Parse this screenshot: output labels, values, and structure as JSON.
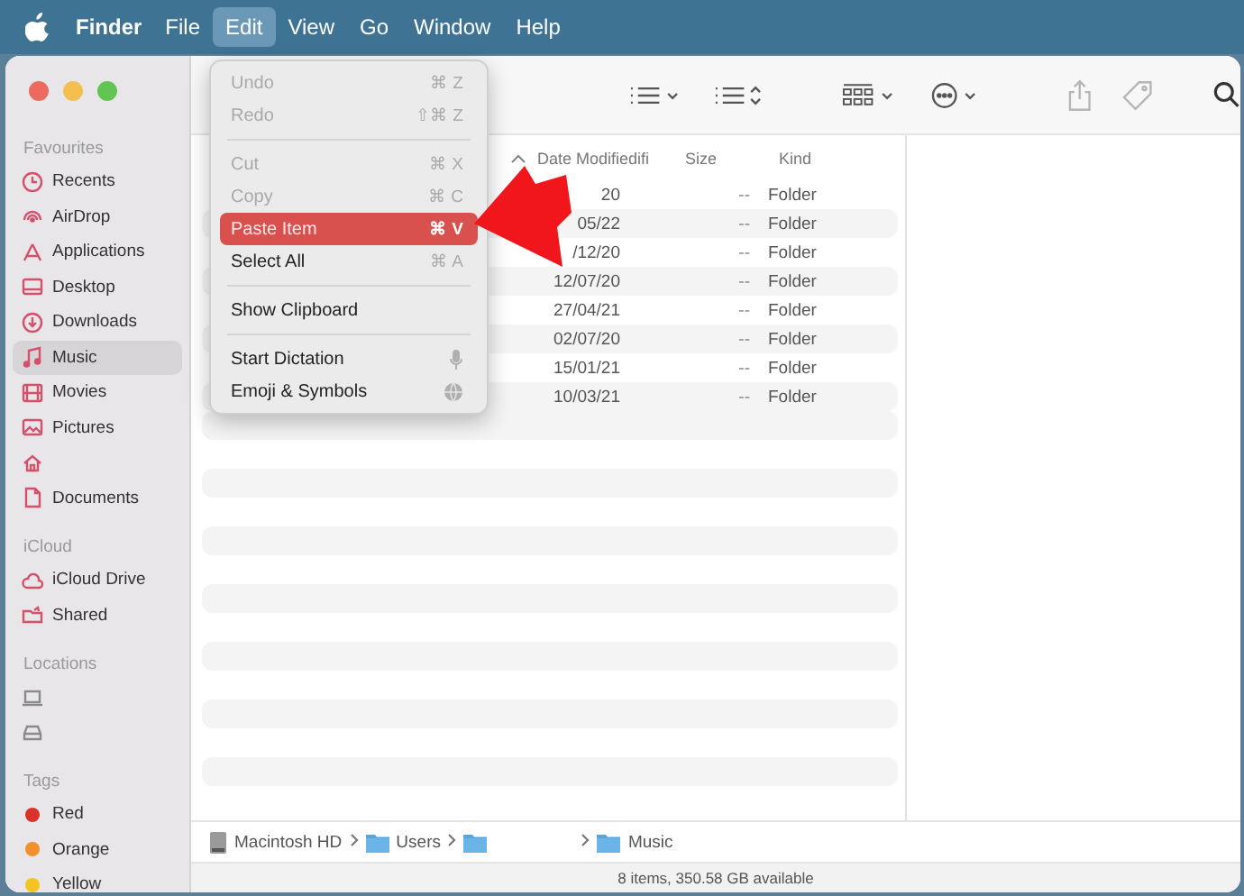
{
  "menu_bar": {
    "app": "Finder",
    "menus": [
      {
        "label": "File",
        "selected": false
      },
      {
        "label": "Edit",
        "selected": true
      },
      {
        "label": "View",
        "selected": false
      },
      {
        "label": "Go",
        "selected": false
      },
      {
        "label": "Window",
        "selected": false
      },
      {
        "label": "Help",
        "selected": false
      }
    ]
  },
  "edit_menu": [
    {
      "kind": "shortcut",
      "label": "Undo",
      "shortcut": "⌘ Z",
      "disabled": true,
      "selected": false
    },
    {
      "kind": "shortcut",
      "label": "Redo",
      "shortcut": "⇧⌘ Z",
      "disabled": true,
      "selected": false
    },
    {
      "kind": "separator"
    },
    {
      "kind": "shortcut",
      "label": "Cut",
      "shortcut": "⌘ X",
      "disabled": true,
      "selected": false
    },
    {
      "kind": "shortcut",
      "label": "Copy",
      "shortcut": "⌘ C",
      "disabled": true,
      "selected": false
    },
    {
      "kind": "shortcut",
      "label": "Paste Item",
      "shortcut": "⌘ V",
      "disabled": false,
      "selected": true
    },
    {
      "kind": "shortcut",
      "label": "Select All",
      "shortcut": "⌘ A",
      "disabled": false,
      "selected": false
    },
    {
      "kind": "separator"
    },
    {
      "kind": "shortcut",
      "label": "Show Clipboard",
      "disabled": false,
      "selected": false
    },
    {
      "kind": "separator"
    },
    {
      "kind": "mic",
      "label": "Start Dictation",
      "disabled": false,
      "selected": false
    },
    {
      "kind": "globe",
      "label": "Emoji & Symbols",
      "disabled": false,
      "selected": false
    }
  ],
  "sidebar": [
    {
      "heading": "Favourites",
      "items": [
        {
          "label": "Recents",
          "selected": false
        },
        {
          "label": "AirDrop",
          "selected": false
        },
        {
          "label": "Applications",
          "selected": false
        },
        {
          "label": "Desktop",
          "selected": false
        },
        {
          "label": "Downloads",
          "selected": false
        },
        {
          "label": "Music",
          "selected": true
        },
        {
          "label": "Movies",
          "selected": false
        },
        {
          "label": "Pictures",
          "selected": false
        },
        {
          "selected": false
        },
        {
          "label": "Documents",
          "selected": false
        }
      ]
    },
    {
      "heading": "iCloud",
      "items": [
        {
          "label": "iCloud Drive",
          "selected": false
        },
        {
          "label": "Shared",
          "selected": false
        }
      ]
    },
    {
      "heading": "Locations",
      "items": [
        {
          "selected": false
        },
        {
          "selected": false
        }
      ]
    },
    {
      "heading": "Tags",
      "items": [
        {
          "label": "Red",
          "color": "#d9312b",
          "selected": false
        },
        {
          "label": "Orange",
          "color": "#f0912e",
          "selected": false
        },
        {
          "label": "Yellow",
          "color": "#f2c522",
          "selected": false
        }
      ]
    }
  ],
  "table": {
    "columns": [
      "Date Modifiedifi",
      "Size",
      "Kind"
    ],
    "rows": [
      {
        "date": "20",
        "size": "--",
        "kind": "Folder"
      },
      {
        "date": "05/22",
        "size": "--",
        "kind": "Folder"
      },
      {
        "date": "/12/20",
        "size": "--",
        "kind": "Folder"
      },
      {
        "date": "12/07/20",
        "size": "--",
        "kind": "Folder"
      },
      {
        "date": "27/04/21",
        "size": "--",
        "kind": "Folder"
      },
      {
        "date": "02/07/20",
        "size": "--",
        "kind": "Folder"
      },
      {
        "date": "15/01/21",
        "size": "--",
        "kind": "Folder"
      },
      {
        "date": "10/03/21",
        "size": "--",
        "kind": "Folder"
      }
    ]
  },
  "path_bar": [
    {
      "kind": "drive",
      "label": "Macintosh HD"
    },
    {
      "kind": "folder",
      "label": "Users"
    },
    {
      "kind": "folder"
    },
    {
      "kind": "folder",
      "label": "Music"
    }
  ],
  "status_bar": "8 items, 350.58 GB available"
}
